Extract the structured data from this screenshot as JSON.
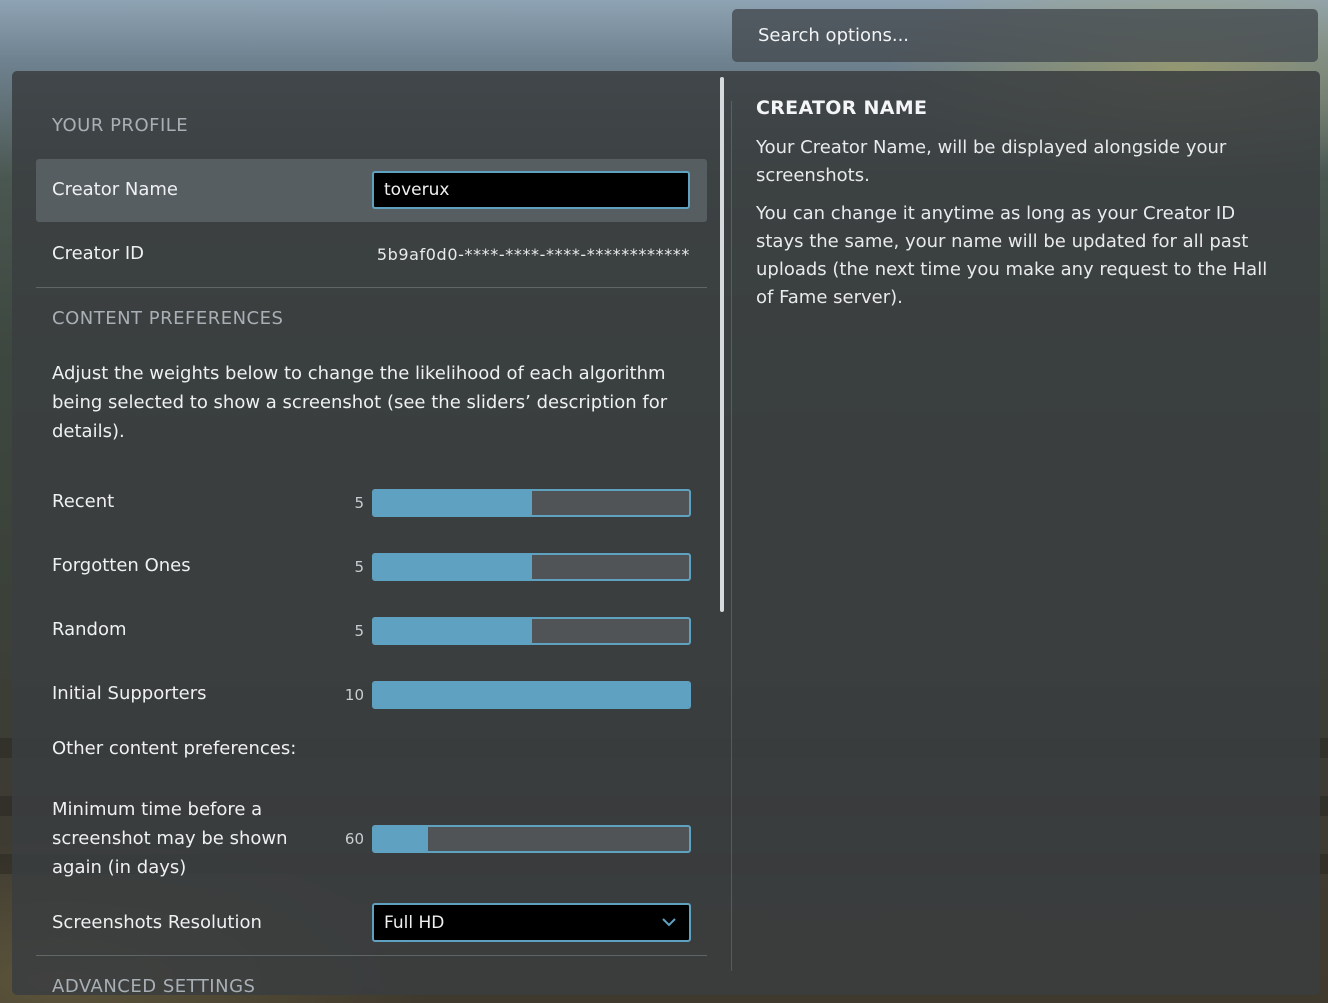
{
  "search": {
    "placeholder": "Search options..."
  },
  "profile": {
    "section_title": "YOUR PROFILE",
    "creator_name_label": "Creator Name",
    "creator_name_value": "toverux",
    "creator_id_label": "Creator ID",
    "creator_id_value": "5b9af0d0-****-****-****-************"
  },
  "content_prefs": {
    "section_title": "CONTENT PREFERENCES",
    "description": "Adjust the weights below to change the likelihood of each algorithm being selected to show a screenshot (see the sliders’ description for details).",
    "sliders": [
      {
        "label": "Recent",
        "value": "5",
        "fraction": 0.5
      },
      {
        "label": "Forgotten Ones",
        "value": "5",
        "fraction": 0.5
      },
      {
        "label": "Random",
        "value": "5",
        "fraction": 0.5
      },
      {
        "label": "Initial Supporters",
        "value": "10",
        "fraction": 1.0
      }
    ],
    "other_label": "Other content preferences:",
    "min_time": {
      "label": "Minimum time before a screenshot may be shown again (in days)",
      "value": "60",
      "fraction": 0.17
    },
    "resolution": {
      "label": "Screenshots Resolution",
      "selected": "Full HD"
    }
  },
  "advanced": {
    "section_title": "ADVANCED SETTINGS"
  },
  "help": {
    "title": "CREATOR NAME",
    "paragraphs": [
      "Your Creator Name, will be displayed alongside your screenshots.",
      "You can change it anytime as long as your Creator ID stays the same, your name will be updated for all past uploads (the next time you make any request to the Hall of Fame server)."
    ]
  },
  "colors": {
    "accent": "#5fa1c1",
    "slider_track": "#505457",
    "panel": "#3a3e40"
  },
  "icons": {
    "dropdown": "chevron-down-icon"
  }
}
